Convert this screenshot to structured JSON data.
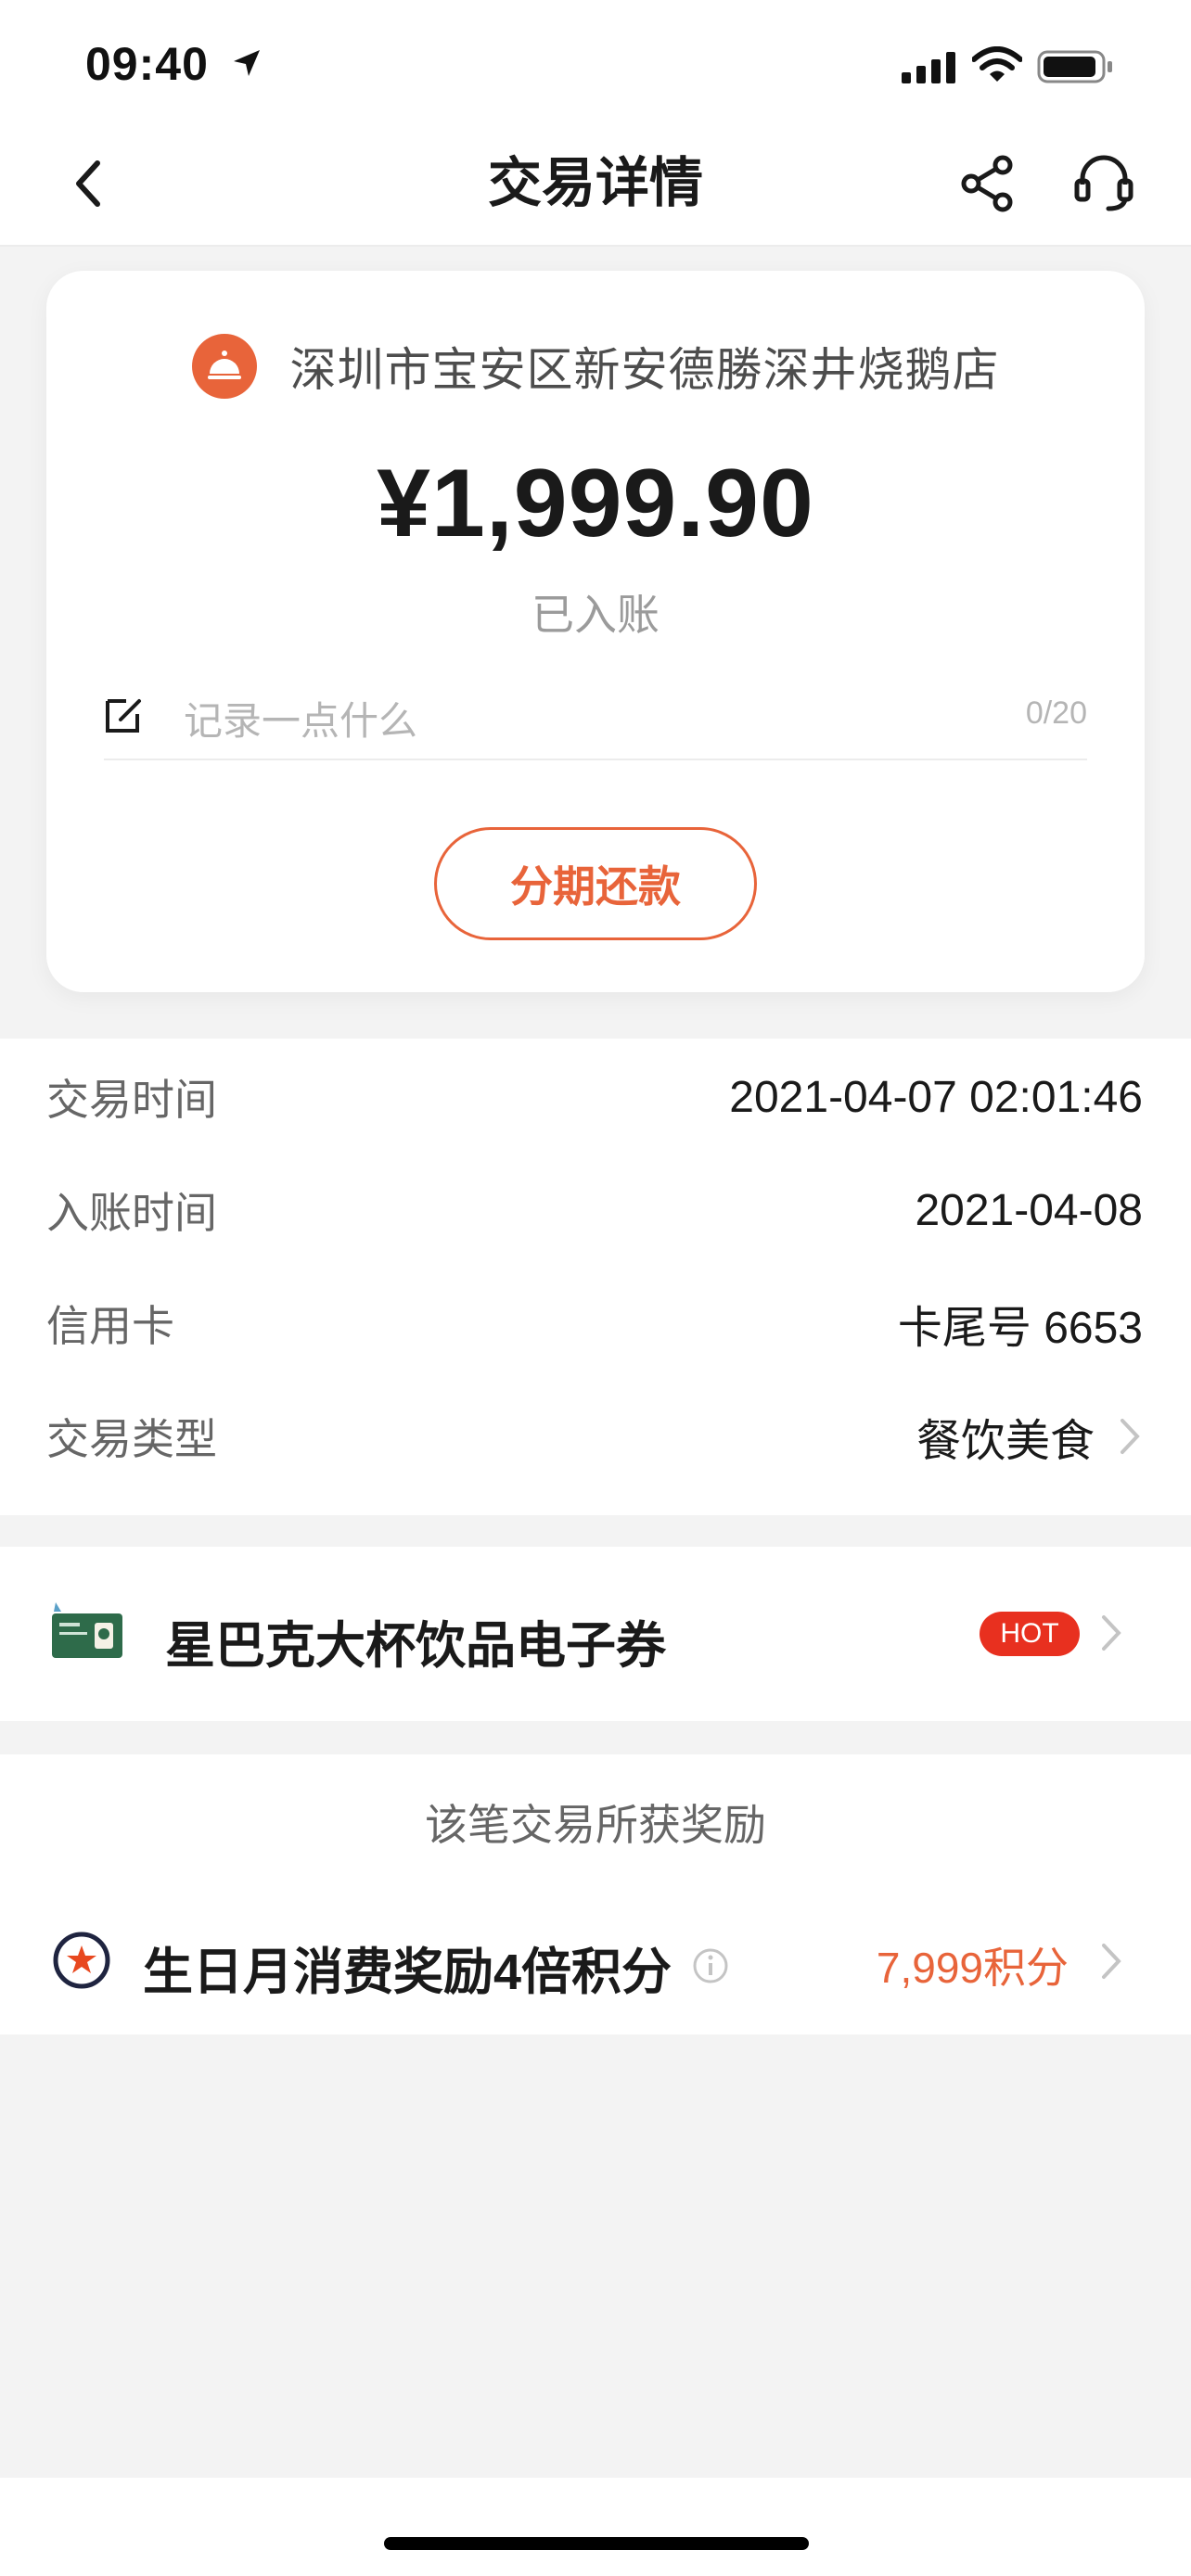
{
  "status_bar": {
    "time": "09:40"
  },
  "nav": {
    "title": "交易详情",
    "icons": [
      "back-icon",
      "share-icon",
      "customer-service-icon"
    ]
  },
  "transaction": {
    "merchant": "深圳市宝安区新安德勝深井烧鹅店",
    "amount": "¥1,999.90",
    "status": "已入账",
    "memo_placeholder": "记录一点什么",
    "memo_count": "0/20",
    "installment_button": "分期还款"
  },
  "details": [
    {
      "label": "交易时间",
      "value": "2021-04-07 02:01:46"
    },
    {
      "label": "入账时间",
      "value": "2021-04-08"
    },
    {
      "label": "信用卡",
      "value": "卡尾号 6653"
    },
    {
      "label": "交易类型",
      "value": "餐饮美食"
    }
  ],
  "coupon": {
    "title": "星巴克大杯饮品电子券",
    "badge": "HOT"
  },
  "rewards": {
    "heading": "该笔交易所获奖励",
    "title": "生日月消费奖励4倍积分",
    "points": "7,999积分"
  },
  "colors": {
    "accent": "#e8643a",
    "hot_badge": "#e8301f"
  }
}
